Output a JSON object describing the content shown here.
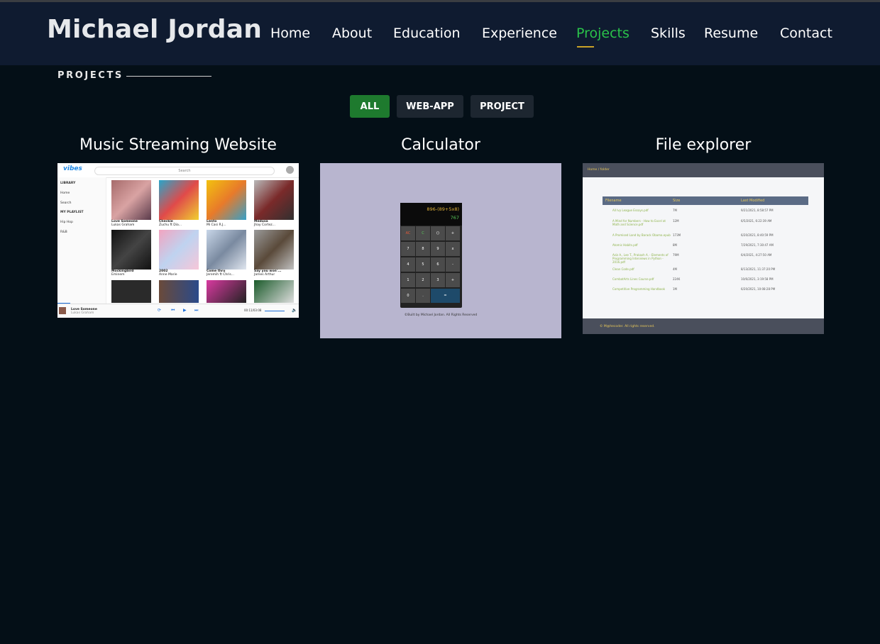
{
  "site": {
    "title": "Michael Jordan"
  },
  "nav": {
    "items": [
      "Home",
      "About",
      "Education",
      "Experience",
      "Projects",
      "Skills",
      "Resume",
      "Contact"
    ],
    "active": "Projects"
  },
  "section": {
    "title": "PROJECTS"
  },
  "filters": {
    "items": [
      "ALL",
      "WEB-APP",
      "PROJECT"
    ],
    "active": "ALL"
  },
  "projects": [
    {
      "title": "Music Streaming Website",
      "preview": {
        "brand": "vibes",
        "search_placeholder": "Search",
        "sidebar": [
          "LIBRARY",
          "Home",
          "Search",
          "MY PLAYLIST",
          "Hip Hop",
          "R&B"
        ],
        "albums": [
          {
            "name": "Love Someone",
            "artist": "Lukas Graham"
          },
          {
            "name": "Checkie",
            "artist": "Zuchu ft Dia..."
          },
          {
            "name": "Lento",
            "artist": "Mi Casi R.J..."
          },
          {
            "name": "Medusa",
            "artist": "Jhay Cortez..."
          },
          {
            "name": "Mockingbird",
            "artist": "Eminem"
          },
          {
            "name": "2002",
            "artist": "Anne Marie"
          },
          {
            "name": "Come thru",
            "artist": "Jeremih ft Chris..."
          },
          {
            "name": "Say you won'...",
            "artist": "James Arthur"
          }
        ],
        "now_playing": {
          "title": "Love Someone",
          "artist": "Lukas Graham",
          "time": "00:11/03:08"
        }
      }
    },
    {
      "title": "Calculator",
      "preview": {
        "expression": "896-(89+5x8)",
        "result": "767",
        "keys": [
          "AC",
          "C",
          "()",
          "+",
          "7",
          "8",
          "9",
          "x",
          "4",
          "5",
          "6",
          "-",
          "1",
          "2",
          "3",
          "+",
          "0",
          ".",
          "="
        ],
        "footer": "©Built by Michael Jordan. All Rights Reserved"
      }
    },
    {
      "title": "File explorer",
      "preview": {
        "breadcrumb": "Home / folder",
        "columns": [
          "Filename",
          "Size",
          "Last Modified"
        ],
        "rows": [
          {
            "name": "All Ivy League Essays.pdf",
            "size": "7M",
            "date": "9/21/2021, 8:58:57 PM"
          },
          {
            "name": "A Mind for Numbers - How to Excel at Math and Science.pdf",
            "size": "12M",
            "date": "6/5/2021, 6:22:39 AM"
          },
          {
            "name": "A Promised Land by Barack Obama.epub",
            "size": "173M",
            "date": "6/20/2021, 8:40:59 PM"
          },
          {
            "name": "Atomic Habits.pdf",
            "size": "8M",
            "date": "7/29/2021, 7:30:47 AM"
          },
          {
            "name": "Aziz A., Lee T., Prakash A. - Elements of Programming Interviews in Python - 2016.pdf",
            "size": "79M",
            "date": "6/4/2021, 4:27:50 AM"
          },
          {
            "name": "Clean Code.pdf",
            "size": "4M",
            "date": "8/13/2021, 11:37:20 PM"
          },
          {
            "name": "CombatArts Lines Course.pdf",
            "size": "224K",
            "date": "10/6/2021, 3:19:58 PM"
          },
          {
            "name": "Competitive Programming Handbook",
            "size": "1M",
            "date": "6/20/2021, 10:08:28 PM"
          }
        ],
        "footer": "© M@hecoder. All rights reserved."
      }
    }
  ]
}
